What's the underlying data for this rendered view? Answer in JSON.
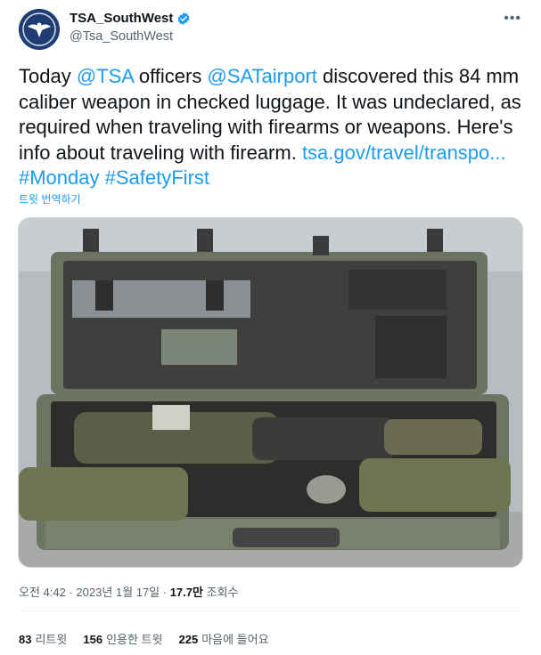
{
  "author": {
    "name": "TSA_SouthWest",
    "handle": "@Tsa_SouthWest"
  },
  "more_label": "•••",
  "tweet": {
    "part1": "Today ",
    "mention1": "@TSA",
    "part2": " officers ",
    "mention2": "@SATairport",
    "part3": " discovered this 84 mm caliber weapon in checked luggage. It was undeclared, as required when traveling with firearms or weapons. Here's info about traveling with firearm. ",
    "link": "tsa.gov/travel/transpo...",
    "hashtag1": "#Monday",
    "hashtag2": "#SafetyFirst"
  },
  "translate_label": "트윗 번역하기",
  "meta": {
    "time": "오전 4:42",
    "sep1": " · ",
    "date": "2023년 1월 17일",
    "sep2": " · ",
    "views_count": "17.7만",
    "views_label": " 조회수"
  },
  "stats": {
    "retweets_count": "83",
    "retweets_label": "리트윗",
    "quotes_count": "156",
    "quotes_label": "인용한 트윗",
    "likes_count": "225",
    "likes_label": "마음에 들어요"
  },
  "colors": {
    "link": "#1d9bf0",
    "secondary_text": "#536471",
    "primary_text": "#0f1419"
  },
  "icons": {
    "avatar": "tsa-eagle-seal",
    "verified": "verified-badge-icon",
    "more": "more-horizontal-icon"
  }
}
